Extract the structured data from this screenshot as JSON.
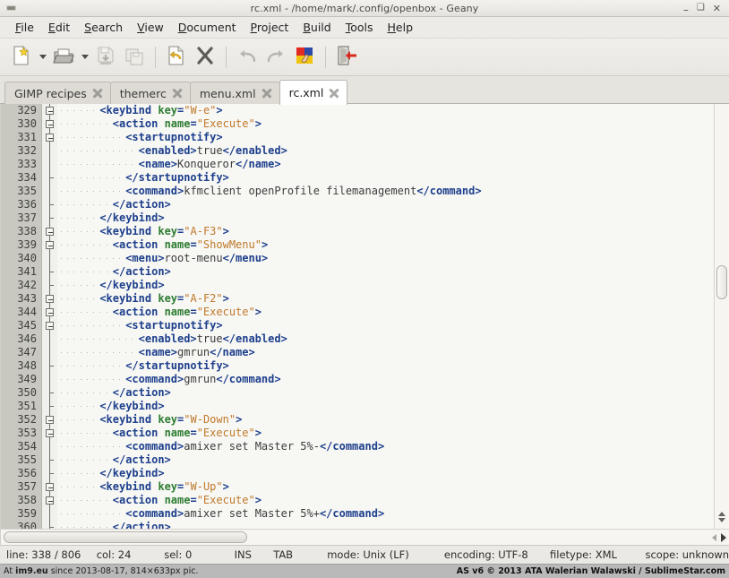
{
  "window": {
    "title": "rc.xml - /home/mark/.config/openbox - Geany",
    "icon": "window-menu-icon",
    "buttons": {
      "minimize": "–",
      "maximize": "❑",
      "close": "✕"
    }
  },
  "menubar": {
    "items": [
      {
        "pre": "",
        "accel": "F",
        "post": "ile"
      },
      {
        "pre": "",
        "accel": "E",
        "post": "dit"
      },
      {
        "pre": "",
        "accel": "S",
        "post": "earch"
      },
      {
        "pre": "",
        "accel": "V",
        "post": "iew"
      },
      {
        "pre": "",
        "accel": "D",
        "post": "ocument"
      },
      {
        "pre": "",
        "accel": "P",
        "post": "roject"
      },
      {
        "pre": "",
        "accel": "B",
        "post": "uild"
      },
      {
        "pre": "",
        "accel": "T",
        "post": "ools"
      },
      {
        "pre": "",
        "accel": "H",
        "post": "elp"
      }
    ]
  },
  "toolbar": {
    "items": [
      {
        "name": "new-document-button",
        "kind": "icon",
        "icon": "new-document-icon",
        "enabled": true
      },
      {
        "name": "new-document-dropdown",
        "kind": "arrow",
        "icon": "chevron-down-icon",
        "enabled": true
      },
      {
        "name": "open-file-button",
        "kind": "icon",
        "icon": "open-folder-icon",
        "enabled": true
      },
      {
        "name": "open-file-dropdown",
        "kind": "arrow",
        "icon": "chevron-down-icon",
        "enabled": true
      },
      {
        "name": "save-button",
        "kind": "icon",
        "icon": "save-icon",
        "enabled": false
      },
      {
        "name": "save-all-button",
        "kind": "icon",
        "icon": "save-all-icon",
        "enabled": false
      },
      {
        "name": "separator-1",
        "kind": "sep"
      },
      {
        "name": "revert-button",
        "kind": "icon",
        "icon": "reload-document-icon",
        "enabled": true
      },
      {
        "name": "close-document-button",
        "kind": "icon",
        "icon": "close-x-icon",
        "enabled": true
      },
      {
        "name": "separator-2",
        "kind": "sep"
      },
      {
        "name": "undo-button",
        "kind": "icon",
        "icon": "undo-arrow-icon",
        "enabled": false
      },
      {
        "name": "redo-button",
        "kind": "icon",
        "icon": "redo-arrow-icon",
        "enabled": false
      },
      {
        "name": "compile-button",
        "kind": "icon",
        "icon": "color-chooser-icon",
        "enabled": true
      },
      {
        "name": "separator-3",
        "kind": "sep"
      },
      {
        "name": "quit-button",
        "kind": "icon",
        "icon": "quit-door-icon",
        "enabled": true
      }
    ]
  },
  "tabs": [
    {
      "label": "GIMP recipes",
      "active": false
    },
    {
      "label": "themerc",
      "active": false
    },
    {
      "label": "menu.xml",
      "active": false
    },
    {
      "label": "rc.xml",
      "active": true
    }
  ],
  "editor": {
    "first_line": 329,
    "lines": [
      {
        "n": "329",
        "fold": "box",
        "indent": 3,
        "tokens": [
          {
            "t": "tag",
            "v": "<keybind"
          },
          {
            "t": "sp",
            "v": " "
          },
          {
            "t": "attr",
            "v": "key"
          },
          {
            "t": "eq",
            "v": "="
          },
          {
            "t": "str",
            "v": "\"W-e\""
          },
          {
            "t": "tag",
            "v": ">"
          }
        ]
      },
      {
        "n": "330",
        "fold": "box",
        "indent": 4,
        "tokens": [
          {
            "t": "tag",
            "v": "<action"
          },
          {
            "t": "sp",
            "v": " "
          },
          {
            "t": "attr",
            "v": "name"
          },
          {
            "t": "eq",
            "v": "="
          },
          {
            "t": "str",
            "v": "\"Execute\""
          },
          {
            "t": "tag",
            "v": ">"
          }
        ]
      },
      {
        "n": "331",
        "fold": "box",
        "indent": 5,
        "tokens": [
          {
            "t": "tag",
            "v": "<startupnotify>"
          }
        ]
      },
      {
        "n": "332",
        "fold": "line",
        "indent": 6,
        "tokens": [
          {
            "t": "tag",
            "v": "<enabled>"
          },
          {
            "t": "txt",
            "v": "true"
          },
          {
            "t": "tag",
            "v": "</enabled>"
          }
        ]
      },
      {
        "n": "333",
        "fold": "line",
        "indent": 6,
        "tokens": [
          {
            "t": "tag",
            "v": "<name>"
          },
          {
            "t": "txt",
            "v": "Konqueror"
          },
          {
            "t": "tag",
            "v": "</name>"
          }
        ]
      },
      {
        "n": "334",
        "fold": "tick",
        "indent": 5,
        "tokens": [
          {
            "t": "tag",
            "v": "</startupnotify>"
          }
        ]
      },
      {
        "n": "335",
        "fold": "line",
        "indent": 5,
        "tokens": [
          {
            "t": "tag",
            "v": "<command>"
          },
          {
            "t": "txt",
            "v": "kfmclient openProfile filemanagement"
          },
          {
            "t": "tag",
            "v": "</command>"
          }
        ]
      },
      {
        "n": "336",
        "fold": "tick",
        "indent": 4,
        "tokens": [
          {
            "t": "tag",
            "v": "</action>"
          }
        ]
      },
      {
        "n": "337",
        "fold": "tick",
        "indent": 3,
        "tokens": [
          {
            "t": "tag",
            "v": "</keybind>"
          }
        ]
      },
      {
        "n": "338",
        "fold": "box",
        "indent": 3,
        "tokens": [
          {
            "t": "tag",
            "v": "<keybind"
          },
          {
            "t": "sp",
            "v": " "
          },
          {
            "t": "attr",
            "v": "key"
          },
          {
            "t": "eq",
            "v": "="
          },
          {
            "t": "str",
            "v": "\"A-F3\""
          },
          {
            "t": "tag",
            "v": ">"
          }
        ]
      },
      {
        "n": "339",
        "fold": "box",
        "indent": 4,
        "tokens": [
          {
            "t": "tag",
            "v": "<action"
          },
          {
            "t": "sp",
            "v": " "
          },
          {
            "t": "attr",
            "v": "name"
          },
          {
            "t": "eq",
            "v": "="
          },
          {
            "t": "str",
            "v": "\"ShowMenu\""
          },
          {
            "t": "tag",
            "v": ">"
          }
        ]
      },
      {
        "n": "340",
        "fold": "line",
        "indent": 5,
        "tokens": [
          {
            "t": "tag",
            "v": "<menu>"
          },
          {
            "t": "txt",
            "v": "root-menu"
          },
          {
            "t": "tag",
            "v": "</menu>"
          }
        ]
      },
      {
        "n": "341",
        "fold": "tick",
        "indent": 4,
        "tokens": [
          {
            "t": "tag",
            "v": "</action>"
          }
        ]
      },
      {
        "n": "342",
        "fold": "tick",
        "indent": 3,
        "tokens": [
          {
            "t": "tag",
            "v": "</keybind>"
          }
        ]
      },
      {
        "n": "343",
        "fold": "box",
        "indent": 3,
        "tokens": [
          {
            "t": "tag",
            "v": "<keybind"
          },
          {
            "t": "sp",
            "v": " "
          },
          {
            "t": "attr",
            "v": "key"
          },
          {
            "t": "eq",
            "v": "="
          },
          {
            "t": "str",
            "v": "\"A-F2\""
          },
          {
            "t": "tag",
            "v": ">"
          }
        ]
      },
      {
        "n": "344",
        "fold": "box",
        "indent": 4,
        "tokens": [
          {
            "t": "tag",
            "v": "<action"
          },
          {
            "t": "sp",
            "v": " "
          },
          {
            "t": "attr",
            "v": "name"
          },
          {
            "t": "eq",
            "v": "="
          },
          {
            "t": "str",
            "v": "\"Execute\""
          },
          {
            "t": "tag",
            "v": ">"
          }
        ]
      },
      {
        "n": "345",
        "fold": "box",
        "indent": 5,
        "tokens": [
          {
            "t": "tag",
            "v": "<startupnotify>"
          }
        ]
      },
      {
        "n": "346",
        "fold": "line",
        "indent": 6,
        "tokens": [
          {
            "t": "tag",
            "v": "<enabled>"
          },
          {
            "t": "txt",
            "v": "true"
          },
          {
            "t": "tag",
            "v": "</enabled>"
          }
        ]
      },
      {
        "n": "347",
        "fold": "line",
        "indent": 6,
        "tokens": [
          {
            "t": "tag",
            "v": "<name>"
          },
          {
            "t": "txt",
            "v": "gmrun"
          },
          {
            "t": "tag",
            "v": "</name>"
          }
        ]
      },
      {
        "n": "348",
        "fold": "tick",
        "indent": 5,
        "tokens": [
          {
            "t": "tag",
            "v": "</startupnotify>"
          }
        ]
      },
      {
        "n": "349",
        "fold": "line",
        "indent": 5,
        "tokens": [
          {
            "t": "tag",
            "v": "<command>"
          },
          {
            "t": "txt",
            "v": "gmrun"
          },
          {
            "t": "tag",
            "v": "</command>"
          }
        ]
      },
      {
        "n": "350",
        "fold": "tick",
        "indent": 4,
        "tokens": [
          {
            "t": "tag",
            "v": "</action>"
          }
        ]
      },
      {
        "n": "351",
        "fold": "tick",
        "indent": 3,
        "tokens": [
          {
            "t": "tag",
            "v": "</keybind>"
          }
        ]
      },
      {
        "n": "352",
        "fold": "box",
        "indent": 3,
        "tokens": [
          {
            "t": "tag",
            "v": "<keybind"
          },
          {
            "t": "sp",
            "v": " "
          },
          {
            "t": "attr",
            "v": "key"
          },
          {
            "t": "eq",
            "v": "="
          },
          {
            "t": "str",
            "v": "\"W-Down\""
          },
          {
            "t": "tag",
            "v": ">"
          }
        ]
      },
      {
        "n": "353",
        "fold": "box",
        "indent": 4,
        "tokens": [
          {
            "t": "tag",
            "v": "<action"
          },
          {
            "t": "sp",
            "v": " "
          },
          {
            "t": "attr",
            "v": "name"
          },
          {
            "t": "eq",
            "v": "="
          },
          {
            "t": "str",
            "v": "\"Execute\""
          },
          {
            "t": "tag",
            "v": ">"
          }
        ]
      },
      {
        "n": "354",
        "fold": "line",
        "indent": 5,
        "tokens": [
          {
            "t": "tag",
            "v": "<command>"
          },
          {
            "t": "txt",
            "v": "amixer set Master 5%-"
          },
          {
            "t": "tag",
            "v": "</command>"
          }
        ]
      },
      {
        "n": "355",
        "fold": "tick",
        "indent": 4,
        "tokens": [
          {
            "t": "tag",
            "v": "</action>"
          }
        ]
      },
      {
        "n": "356",
        "fold": "tick",
        "indent": 3,
        "tokens": [
          {
            "t": "tag",
            "v": "</keybind>"
          }
        ]
      },
      {
        "n": "357",
        "fold": "box",
        "indent": 3,
        "tokens": [
          {
            "t": "tag",
            "v": "<keybind"
          },
          {
            "t": "sp",
            "v": " "
          },
          {
            "t": "attr",
            "v": "key"
          },
          {
            "t": "eq",
            "v": "="
          },
          {
            "t": "str",
            "v": "\"W-Up\""
          },
          {
            "t": "tag",
            "v": ">"
          }
        ]
      },
      {
        "n": "358",
        "fold": "box",
        "indent": 4,
        "tokens": [
          {
            "t": "tag",
            "v": "<action"
          },
          {
            "t": "sp",
            "v": " "
          },
          {
            "t": "attr",
            "v": "name"
          },
          {
            "t": "eq",
            "v": "="
          },
          {
            "t": "str",
            "v": "\"Execute\""
          },
          {
            "t": "tag",
            "v": ">"
          }
        ]
      },
      {
        "n": "359",
        "fold": "line",
        "indent": 5,
        "tokens": [
          {
            "t": "tag",
            "v": "<command>"
          },
          {
            "t": "txt",
            "v": "amixer set Master 5%+"
          },
          {
            "t": "tag",
            "v": "</command>"
          }
        ]
      },
      {
        "n": "360",
        "fold": "tick",
        "indent": 4,
        "tokens": [
          {
            "t": "tag",
            "v": "</action>"
          }
        ]
      }
    ]
  },
  "statusbar": {
    "line": "line: 338 / 806",
    "col": "col: 24",
    "sel": "sel: 0",
    "overwrite": "INS",
    "indent": "TAB",
    "mode": "mode: Unix (LF)",
    "encoding": "encoding: UTF-8",
    "filetype": "filetype: XML",
    "scope": "scope: unknown"
  },
  "watermark": {
    "left_prefix": "At ",
    "left_site": "im9.eu",
    "left_suffix": " since 2013-08-17, 814×633px pic.",
    "right": "AS v6 © 2013 ATA Walerian Walawski / SublimeStar.com"
  },
  "colors": {
    "tag": "#1d3f8c",
    "attr": "#2e7d32",
    "string": "#c07a2b",
    "text": "#3c3c3c",
    "gutter_bg": "#c8c8c0",
    "editor_bg": "#f7f7f4",
    "chrome_bg": "#efefec"
  }
}
